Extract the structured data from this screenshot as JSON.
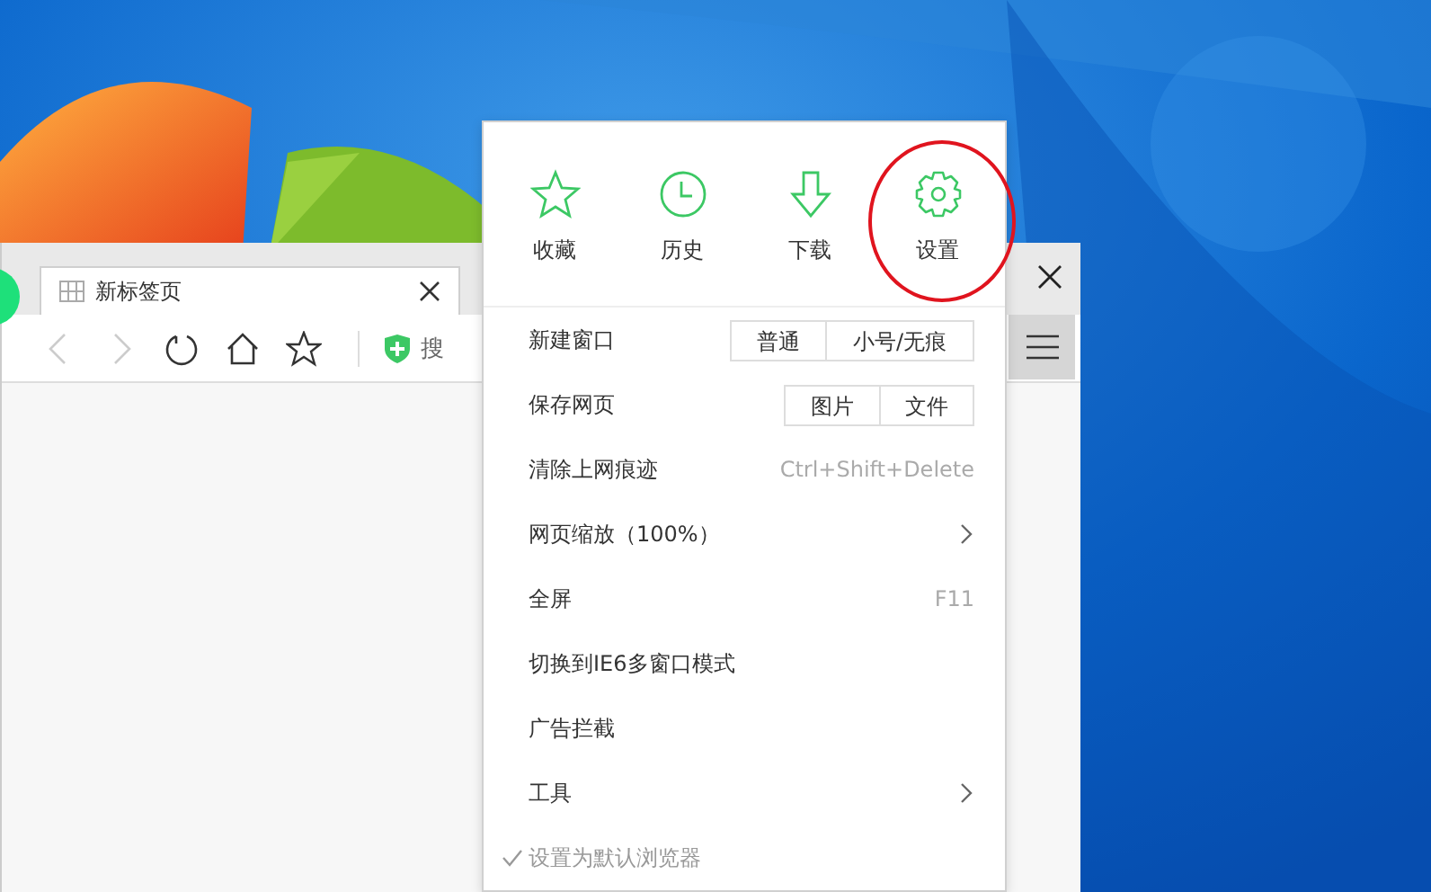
{
  "browser": {
    "tab": {
      "title": "新标签页"
    },
    "toolbar": {
      "search_label": "搜"
    }
  },
  "menu": {
    "quick": [
      {
        "kind": "star",
        "label": "收藏",
        "circled": false
      },
      {
        "kind": "clock",
        "label": "历史",
        "circled": false
      },
      {
        "kind": "download",
        "label": "下载",
        "circled": false
      },
      {
        "kind": "gear",
        "label": "设置",
        "circled": true
      }
    ],
    "items": [
      {
        "kind": "buttons",
        "label": "新建窗口",
        "buttons": [
          "普通",
          "小号/无痕"
        ]
      },
      {
        "kind": "buttons",
        "label": "保存网页",
        "buttons": [
          "图片",
          "文件"
        ]
      },
      {
        "kind": "shortcut",
        "label": "清除上网痕迹",
        "shortcut": "Ctrl+Shift+Delete"
      },
      {
        "kind": "submenu",
        "label": "网页缩放（100%）"
      },
      {
        "kind": "shortcut",
        "label": "全屏",
        "shortcut": "F11"
      },
      {
        "kind": "plain",
        "label": "切换到IE6多窗口模式"
      },
      {
        "kind": "plain",
        "label": "广告拦截"
      },
      {
        "kind": "submenu",
        "label": "工具"
      },
      {
        "kind": "check",
        "label": "设置为默认浏览器",
        "checked": true
      }
    ]
  }
}
